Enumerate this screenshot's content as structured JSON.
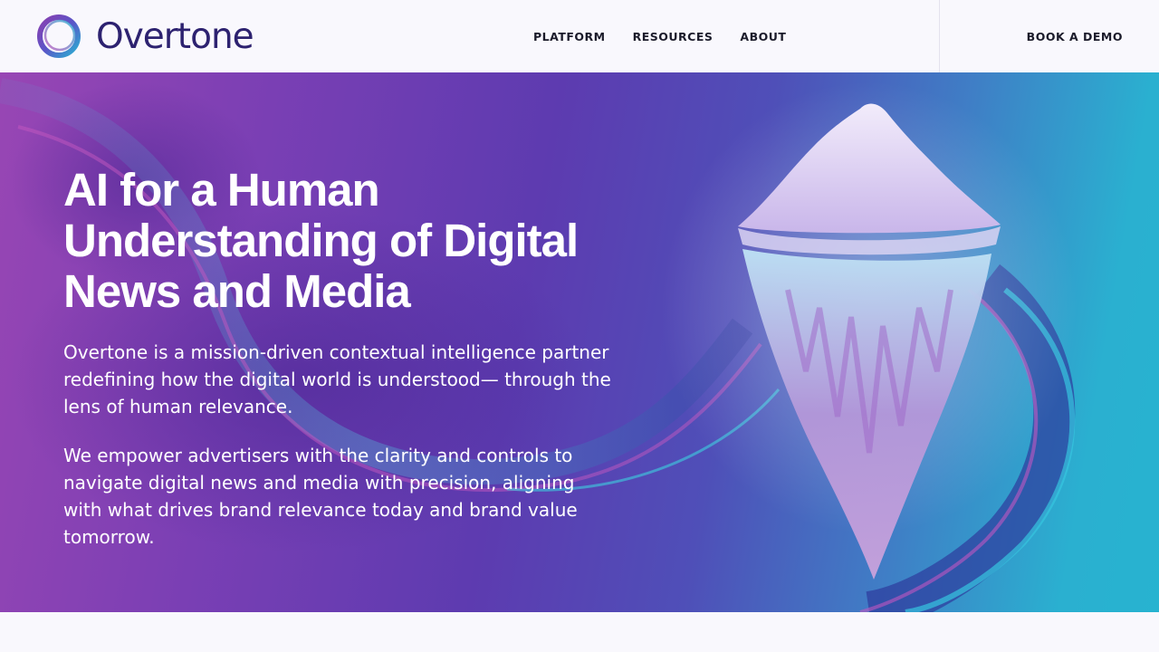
{
  "brand": {
    "name": "Overtone",
    "accent": "#2d2270",
    "logo_icon": "ring-logo-icon"
  },
  "nav": {
    "items": [
      {
        "label": "PLATFORM"
      },
      {
        "label": "RESOURCES"
      },
      {
        "label": "ABOUT"
      }
    ],
    "cta": "BOOK A DEMO"
  },
  "hero": {
    "title": "AI for a Human Understanding of Digital News and Media",
    "paragraph_1": "Overtone is a mission-driven contextual intelligence partner redefining how the digital world is understood— through the lens of human relevance.",
    "paragraph_2": "We empower advertisers with the clarity and controls to navigate digital news and media with precision, aligning with what drives brand relevance today and brand value tomorrow.",
    "image": "iceberg-illustration",
    "colors": {
      "purple": "#9846b4",
      "teal": "#27b3d0"
    }
  }
}
